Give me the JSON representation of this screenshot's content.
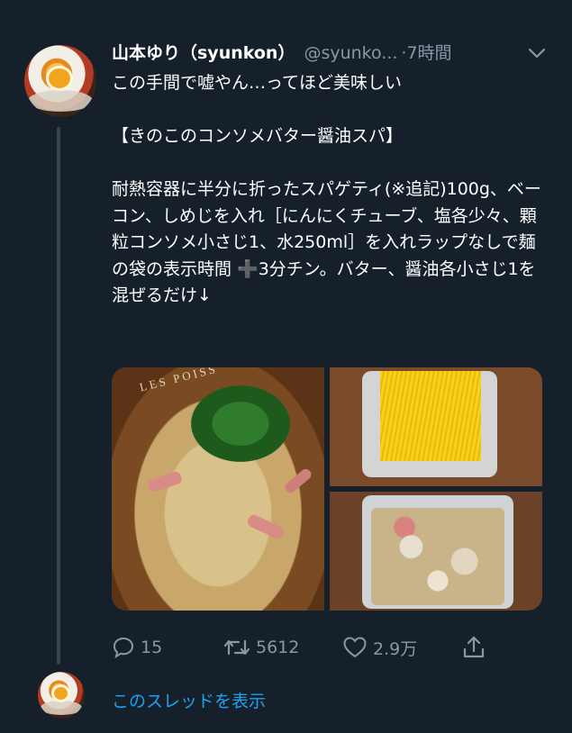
{
  "tweet": {
    "display_name": "山本ゆり（syunkon）",
    "handle": "@syunko...",
    "separator": "·",
    "time": "7時間",
    "text": "この手間で嘘やん…ってほど美味しい\n\n【きのこのコンソメバター醤油スパ】\n\n耐熱容器に半分に折ったスパゲティ(※追記)100g、ベーコン、しめじを入れ［にんにくチューブ、塩各少々、顆粒コンソメ小さじ1、水250ml］を入れラップなしで麺の袋の表示時間 ➕3分チン。バター、醤油各小さじ1を混ぜるだけ↓",
    "plate_text": "LES POISS"
  },
  "actions": {
    "reply_count": "15",
    "retweet_count": "5612",
    "like_count": "2.9万"
  },
  "show_thread_label": "このスレッドを表示",
  "colors": {
    "background": "#15202b",
    "secondary_text": "#8899a6",
    "link": "#1da1f2",
    "thread_line": "#38444d"
  },
  "icons": [
    "reply-icon",
    "retweet-icon",
    "like-icon",
    "share-icon",
    "chevron-down-icon"
  ]
}
